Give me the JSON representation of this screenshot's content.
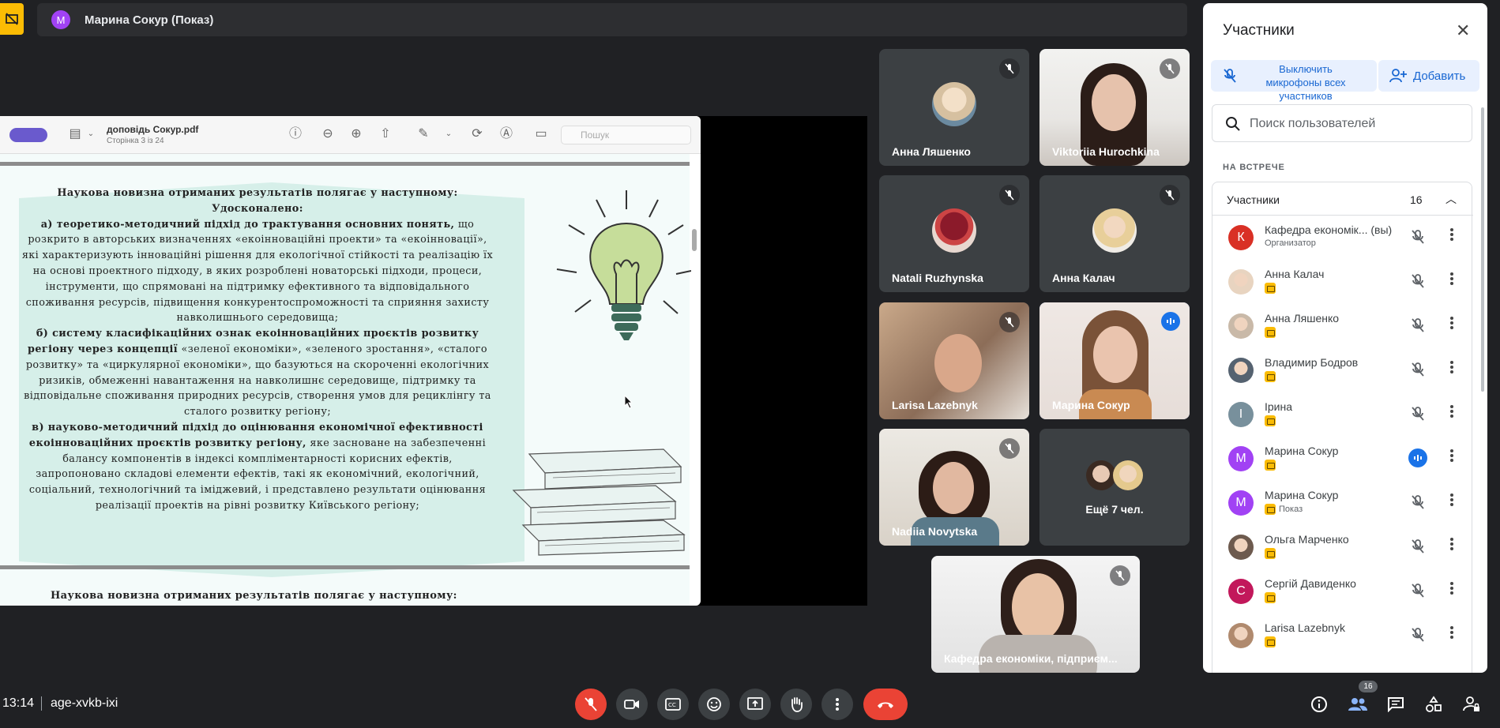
{
  "presenter_bar": {
    "avatar_letter": "M",
    "title": "Марина Сокур (Показ)"
  },
  "pdf": {
    "filename": "доповідь Сокур.pdf",
    "page_info": "Сторінка 3 із 24",
    "search_placeholder": "Пошук",
    "heading1": "Наукова новизна отриманих результатів полягає у наступному:",
    "heading2": "Удосконалено:",
    "a_bold": "а) теоретико-методичний підхід до трактування основних понять,",
    "a_text": " що розкрито в авторських визначеннях «екоінноваційні проекти» та «екоінновації», які характеризують інноваційні рішення для екологічної стійкості та реалізацію їх на основі проектного підходу, в яких розроблені новаторські підходи, процеси, інструменти, що спрямовані на підтримку ефективного та відповідального споживання ресурсів, підвищення конкурентоспроможності та сприяння захисту навколишнього середовища;",
    "b_bold": "б) систему класифікаційних ознак екоінноваційних проєктів розвитку регіону через концепції",
    "b_text": " «зеленої економіки», «зеленого зростання», «сталого розвитку» та «циркулярної економіки», що базуються на скороченні екологічних ризиків, обмеженні навантаження на навколишнє середовище, підтримку та відповідальне споживання природних ресурсів, створення умов для рециклінгу та сталого розвитку регіону;",
    "c_bold": "в) науково-методичний підхід до оцінювання економічної ефективності екоінноваційних проєктів розвитку регіону,",
    "c_text": " яке засноване на забезпеченні балансу компонентів в індексі компліментарності корисних ефектів, запропоновано складові елементи ефектів, такі як економічний, екологічний, соціальний, технологічний та іміджевий, і представлено результати оцінювання реалізації проектів на рівні розвитку Київського регіону;",
    "next_heading": "Наукова новизна отриманих результатів полягає у наступному:"
  },
  "tiles": [
    {
      "name": "Анна Ляшенко"
    },
    {
      "name": "Viktoriia Hurochkina"
    },
    {
      "name": "Natali Ruzhynska"
    },
    {
      "name": "Анна Калач"
    },
    {
      "name": "Larisa Lazebnyk"
    },
    {
      "name": "Марина Сокур"
    },
    {
      "name": "Nadiia Novytska"
    },
    {
      "name": "Ещё 7 чел."
    },
    {
      "name": "Кафедра економіки, підприєм..."
    }
  ],
  "panel": {
    "title": "Участники",
    "mute_all": "Выключить микрофоны всех участников",
    "add": "Добавить",
    "search_placeholder": "Поиск пользователей",
    "section": "НА ВСТРЕЧЕ",
    "group_label": "Участники",
    "group_count": "16",
    "participants": [
      {
        "name": "Кафедра економік... (вы)",
        "sub": "Организатор",
        "letter": "К",
        "color": "#d93025"
      },
      {
        "name": "Анна Калач",
        "sub": "",
        "letter": "",
        "color": "#e8d4c0"
      },
      {
        "name": "Анна Ляшенко",
        "sub": "",
        "letter": "",
        "color": "#c9b9a8"
      },
      {
        "name": "Владимир Бодров",
        "sub": "",
        "letter": "",
        "color": "#556270"
      },
      {
        "name": "Ірина",
        "sub": "",
        "letter": "І",
        "color": "#78909c"
      },
      {
        "name": "Марина Сокур",
        "sub": "",
        "letter": "M",
        "color": "#a142f4"
      },
      {
        "name": "Марина Сокур",
        "sub": "Показ",
        "letter": "M",
        "color": "#a142f4"
      },
      {
        "name": "Ольга Марченко",
        "sub": "",
        "letter": "",
        "color": "#6d5a4e"
      },
      {
        "name": "Сергій Давиденко",
        "sub": "",
        "letter": "С",
        "color": "#c2185b"
      },
      {
        "name": "Larisa Lazebnyk",
        "sub": "",
        "letter": "",
        "color": "#b08a6e"
      }
    ]
  },
  "bottom": {
    "time": "13:14",
    "meeting_code": "age-xvkb-ixi",
    "people_count": "16"
  },
  "colors": {
    "accent_red": "#ea4335",
    "accent_blue": "#1a73e8",
    "badge_yellow": "#fbbc04"
  }
}
